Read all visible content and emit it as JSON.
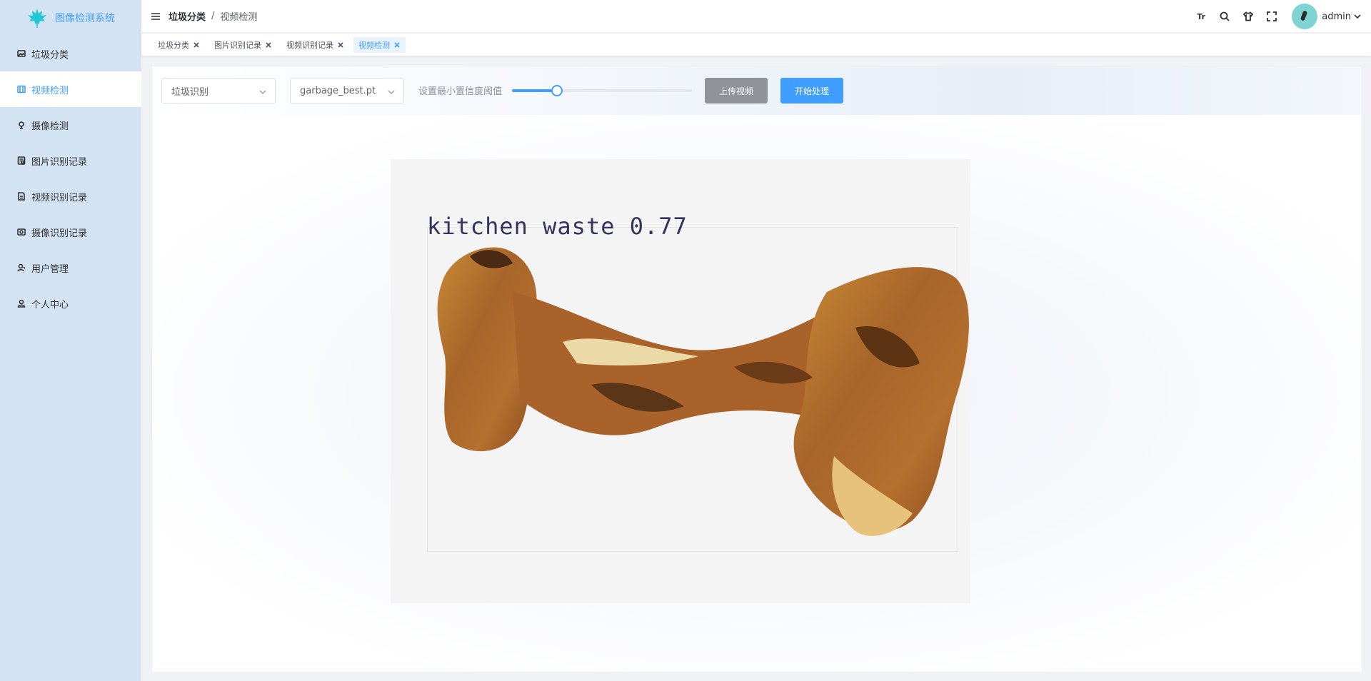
{
  "app": {
    "title": "图像检测系统",
    "logo_icon": "maple-leaf-icon"
  },
  "sidebar": {
    "items": [
      {
        "label": "垃圾分类",
        "icon": "picture-icon",
        "active": false
      },
      {
        "label": "视频检测",
        "icon": "video-icon",
        "active": true
      },
      {
        "label": "摄像检测",
        "icon": "camera-icon",
        "active": false
      },
      {
        "label": "图片识别记录",
        "icon": "image-record-icon",
        "active": false
      },
      {
        "label": "视频识别记录",
        "icon": "video-record-icon",
        "active": false
      },
      {
        "label": "摄像识别记录",
        "icon": "camera-record-icon",
        "active": false
      },
      {
        "label": "用户管理",
        "icon": "user-manage-icon",
        "active": false
      },
      {
        "label": "个人中心",
        "icon": "user-icon",
        "active": false
      }
    ]
  },
  "header": {
    "breadcrumb": [
      "垃圾分类",
      "视频检测"
    ],
    "font_size_icon_text": "Tr",
    "username": "admin"
  },
  "tags": [
    {
      "label": "垃圾分类",
      "active": false
    },
    {
      "label": "图片识别记录",
      "active": false
    },
    {
      "label": "视频识别记录",
      "active": false
    },
    {
      "label": "视频检测",
      "active": true
    }
  ],
  "toolbar": {
    "task_select": "垃圾识别",
    "model_select": "garbage_best.pt",
    "threshold_label": "设置最小置信度阈值",
    "threshold_value": 0.25,
    "upload_label": "上传视频",
    "start_label": "开始处理"
  },
  "detection": {
    "label": "kitchen waste 0.77"
  },
  "colors": {
    "accent": "#409eff",
    "sidebar_bg": "#d4e3f3",
    "upload_button": "#909399",
    "detection_text": "#33335e"
  }
}
